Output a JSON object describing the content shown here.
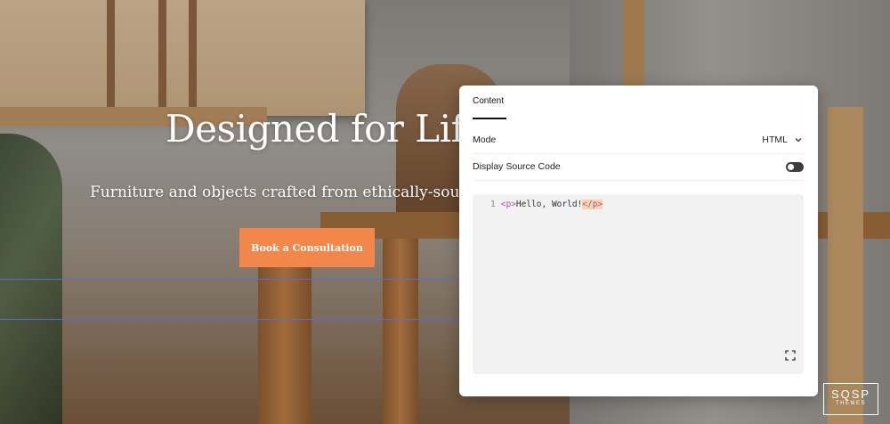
{
  "hero": {
    "title": "Designed for Life",
    "subtitle": "Furniture and objects crafted from ethically-sourced ha",
    "cta_label": "Book a Consultation"
  },
  "panel": {
    "tab_label": "Content",
    "mode_label": "Mode",
    "mode_value": "HTML",
    "source_label": "Display Source Code",
    "source_toggle_on": false
  },
  "editor": {
    "line_number": "1",
    "tag_open": "<p>",
    "text": "Hello, World!",
    "tag_close": "</p>"
  },
  "watermark": {
    "main": "SQSP",
    "sub": "THEMES"
  },
  "colors": {
    "cta": "#f1874a",
    "guide": "#5a6bd8",
    "tag": "#b24fb0",
    "tag_highlight": "#f7d7a8"
  }
}
